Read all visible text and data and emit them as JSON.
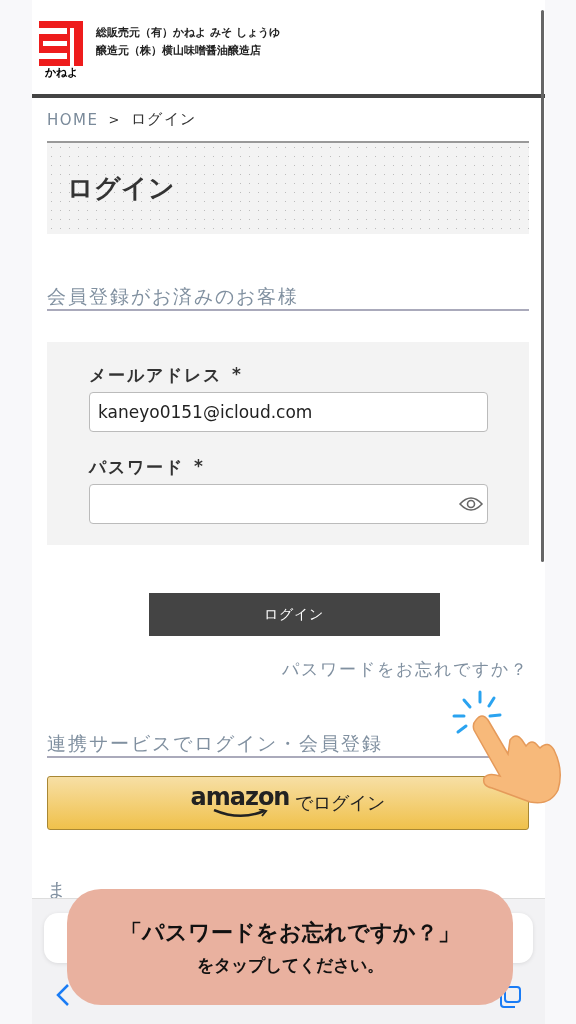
{
  "header": {
    "logo_text": "かねよ",
    "lines": [
      "総販売元（有）かねよ みそ しょうゆ",
      "醸造元（株）横山味噌醤油醸造店"
    ]
  },
  "breadcrumb": [
    {
      "label": "HOME",
      "kind": "link"
    },
    {
      "label": ">",
      "kind": "separator"
    },
    {
      "label": "ログイン",
      "kind": "current"
    }
  ],
  "page_title": "ログイン",
  "member_section": {
    "heading": "会員登録がお済みのお客様",
    "fields": [
      {
        "label": "メールアドレス",
        "required_mark": "*",
        "value": "kaneyo0151@icloud.com",
        "kind": "text"
      },
      {
        "label": "パスワード",
        "required_mark": "*",
        "kind": "password"
      }
    ]
  },
  "login_button": "ログイン",
  "forgot_link": "パスワードをお忘れですか？",
  "social_section": {
    "heading": "連携サービスでログイン・会員登録",
    "amazon_button": {
      "brand": "amazon",
      "label": "でログイン"
    }
  },
  "next_heading_partial": "ま",
  "callout": {
    "lines": [
      "「パスワードをお忘れですか？」",
      "をタップしてください。"
    ]
  }
}
